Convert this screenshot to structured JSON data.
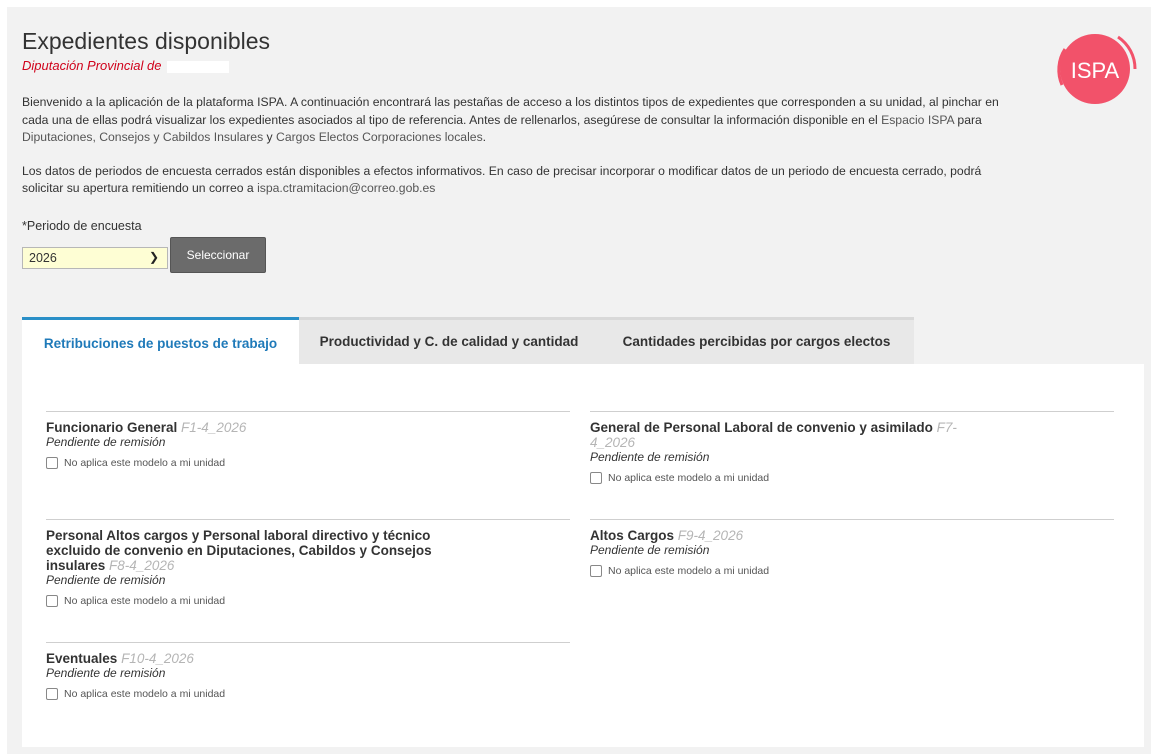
{
  "header": {
    "title": "Expedientes disponibles",
    "subtitle": "Diputación Provincial de",
    "logo_text": "ISPA"
  },
  "intro": {
    "p1_a": "Bienvenido a la aplicación de la plataforma ISPA. A continuación encontrará las pestañas de acceso a los distintos tipos de expedientes que corresponden a su unidad, al pinchar en cada una de ellas podrá visualizar los expedientes asociados al tipo de referencia. Antes de rellenarlos, asegúrese de consultar la información disponible en el ",
    "p1_link1": "Espacio ISPA",
    "p1_b": " para ",
    "p1_link2": "Diputaciones, Consejos y Cabildos Insulares",
    "p1_c": " y ",
    "p1_link3": "Cargos Electos Corporaciones locales",
    "p1_d": ".",
    "p2_a": "Los datos de periodos de encuesta cerrados están disponibles a efectos informativos. En caso de precisar incorporar o modificar datos de un periodo de encuesta cerrado, podrá solicitar su apertura remitiendo un correo a ",
    "p2_email": "ispa.ctramitacion@correo.gob.es"
  },
  "period": {
    "label": "*Periodo de encuesta",
    "selected": "2026",
    "button": "Seleccionar"
  },
  "tabs": [
    {
      "label": "Retribuciones de puestos de trabajo",
      "active": true
    },
    {
      "label": "Productividad y C. de calidad y cantidad",
      "active": false
    },
    {
      "label": "Cantidades percibidas por cargos electos",
      "active": false
    }
  ],
  "cards": [
    {
      "title": "Funcionario General",
      "code": "F1-4_2026",
      "status": "Pendiente de remisión",
      "check": "No aplica este modelo a mi unidad"
    },
    {
      "title": "General de Personal Laboral de convenio y asimilado",
      "code": "F7-4_2026",
      "status": "Pendiente de remisión",
      "check": "No aplica este modelo a mi unidad"
    },
    {
      "title": "Personal Altos cargos y Personal laboral directivo y técnico excluido de convenio en Diputaciones, Cabildos y Consejos insulares",
      "code": "F8-4_2026",
      "status": "Pendiente de remisión",
      "check": "No aplica este modelo a mi unidad"
    },
    {
      "title": "Altos Cargos",
      "code": "F9-4_2026",
      "status": "Pendiente de remisión",
      "check": "No aplica este modelo a mi unidad"
    },
    {
      "title": "Eventuales",
      "code": "F10-4_2026",
      "status": "Pendiente de remisión",
      "check": "No aplica este modelo a mi unidad"
    }
  ],
  "colors": {
    "accent": "#2a8fc7",
    "logo": "#f2526a",
    "subtitle": "#d0021b"
  }
}
